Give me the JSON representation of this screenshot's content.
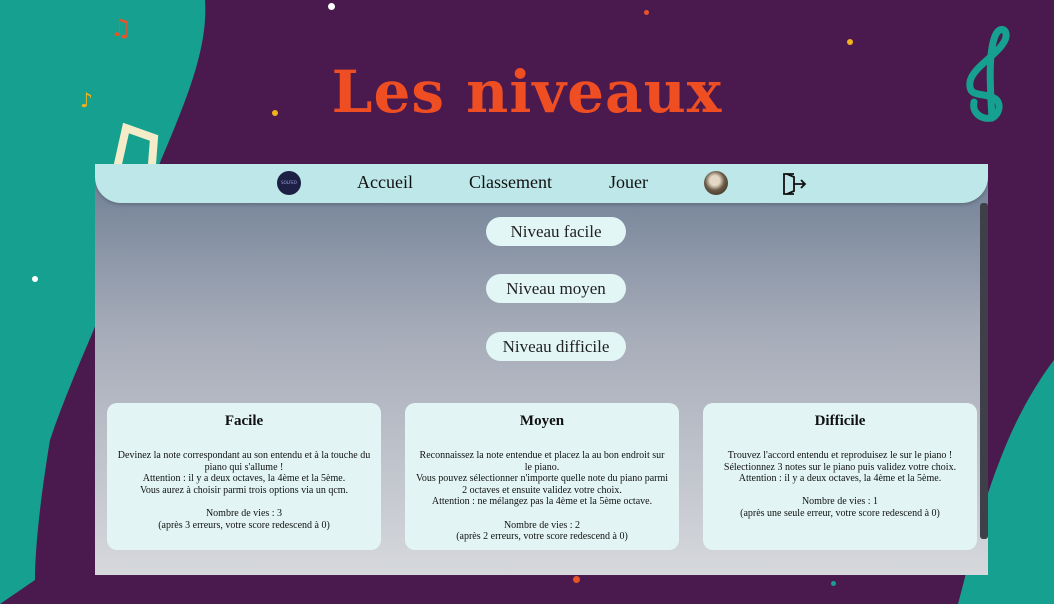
{
  "page": {
    "title": "Les niveaux"
  },
  "nav": {
    "logo_text": "SOLFEO",
    "links": [
      "Accueil",
      "Classement",
      "Jouer"
    ]
  },
  "levels": {
    "buttons": [
      "Niveau facile",
      "Niveau moyen",
      "Niveau difficile"
    ]
  },
  "cards": [
    {
      "title": "Facile",
      "lines": [
        "Devinez la note correspondant au son entendu et à la touche du piano qui s'allume !",
        "Attention : il y a deux octaves, la 4ème et la 5ème.",
        "Vous aurez à choisir parmi trois options via un qcm.",
        "",
        "Nombre de vies : 3",
        "(après 3 erreurs, votre score redescend à 0)"
      ]
    },
    {
      "title": "Moyen",
      "lines": [
        "Reconnaissez la note entendue et placez la au bon endroit sur le piano.",
        "Vous pouvez sélectionner n'importe quelle note du piano parmi 2 octaves et ensuite validez votre choix.",
        "Attention : ne mélangez pas la 4ème et la 5ème octave.",
        "",
        "Nombre de vies : 2",
        "(après 2 erreurs, votre score redescend à 0)"
      ]
    },
    {
      "title": "Difficile",
      "lines": [
        "Trouvez l'accord entendu et reproduisez le sur le piano !",
        "Sélectionnez 3 notes sur le piano puis validez votre choix.",
        "Attention : il y a deux octaves, la 4ème et la 5ème.",
        "",
        "Nombre de vies : 1",
        "(après une seule erreur, votre score redescend à 0)"
      ]
    }
  ],
  "colors": {
    "background": "#4a1a4e",
    "teal": "#16a08f",
    "title": "#ef4e23",
    "navbar": "#bde7e8",
    "card": "#e2f5f4"
  },
  "icons": {
    "logout": "logout-icon",
    "avatar": "avatar",
    "decor": [
      "music-note-icon",
      "treble-clef-icon"
    ]
  }
}
